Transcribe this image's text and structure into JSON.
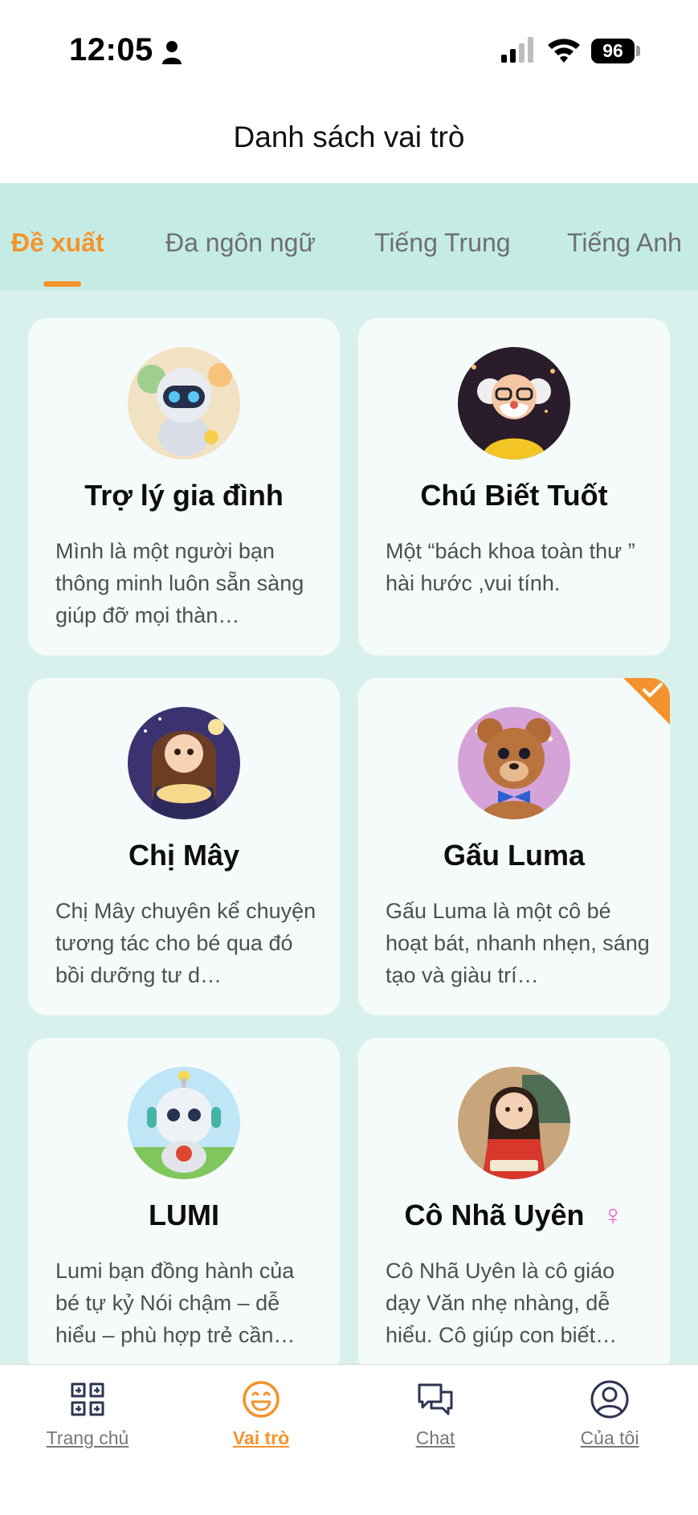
{
  "status_bar": {
    "time": "12:05",
    "battery": "96"
  },
  "header": {
    "title": "Danh sách vai trò"
  },
  "tabs": [
    {
      "label": "Đề xuất",
      "active": true
    },
    {
      "label": "Đa ngôn ngữ",
      "active": false
    },
    {
      "label": "Tiếng Trung",
      "active": false
    },
    {
      "label": "Tiếng Anh",
      "active": false
    }
  ],
  "roles": [
    {
      "name": "Trợ lý gia đình",
      "description": "Mình là một người bạn thông minh luôn sẵn sàng giúp đỡ mọi thàn…",
      "avatar": "robot-assistant-avatar"
    },
    {
      "name": "Chú Biết Tuốt",
      "description": "Một “bách khoa toàn thư ” hài hước ,vui tính.",
      "avatar": "old-man-scientist-avatar"
    },
    {
      "name": "Chị Mây",
      "description": "Chị Mây chuyên kể chuyện tương tác cho bé qua đó bồi dưỡng tư d…",
      "avatar": "storyteller-girl-avatar"
    },
    {
      "name": "Gấu Luma",
      "description": "Gấu Luma là một cô bé hoạt bát, nhanh nhẹn, sáng tạo và giàu trí…",
      "avatar": "bear-avatar",
      "selected": true
    },
    {
      "name": "LUMI",
      "description": "Lumi bạn đồng hành của bé tự kỷ Nói chậm – dễ hiểu – phù hợp trẻ cần…",
      "avatar": "lumi-robot-avatar"
    },
    {
      "name": "Cô Nhã Uyên",
      "gender_symbol": "♀",
      "description": "Cô Nhã Uyên là cô giáo dạy Văn nhẹ nhàng, dễ hiểu. Cô giúp con biết…",
      "avatar": "teacher-avatar"
    }
  ],
  "bottom_nav": [
    {
      "label": "Trang chủ",
      "icon": "home-grid-icon",
      "active": false
    },
    {
      "label": "Vai trò",
      "icon": "smile-icon",
      "active": true
    },
    {
      "label": "Chat",
      "icon": "chat-bubbles-icon",
      "active": false
    },
    {
      "label": "Của tôi",
      "icon": "user-circle-icon",
      "active": false
    }
  ],
  "colors": {
    "accent": "#f4932d",
    "tab_band": "#c4ece4",
    "content_bg": "#d8f1ec",
    "card_bg": "#f5fbfa",
    "female_symbol": "#e569c9"
  }
}
